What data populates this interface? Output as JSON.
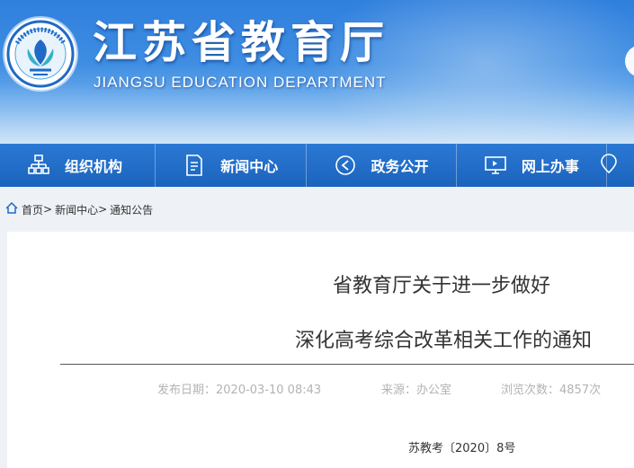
{
  "header": {
    "title": "江苏省教育厅",
    "subtitle": "JIANGSU EDUCATION DEPARTMENT",
    "logo_icon": "jiangsu-education-emblem"
  },
  "nav": {
    "items": [
      {
        "label": "组织机构",
        "icon": "org-chart-icon"
      },
      {
        "label": "新闻中心",
        "icon": "document-icon"
      },
      {
        "label": "政务公开",
        "icon": "announcement-icon"
      },
      {
        "label": "网上办事",
        "icon": "monitor-icon"
      }
    ]
  },
  "breadcrumb": {
    "home": "首页",
    "sep1": ">",
    "news": "新闻中心",
    "sep2": ">",
    "current": "通知公告"
  },
  "article": {
    "title_line1": "省教育厅关于进一步做好",
    "title_line2": "深化高考综合改革相关工作的通知",
    "publish_date": "发布日期：2020-03-10 08:43",
    "source": "来源：办公室",
    "views": "浏览次数：4857次",
    "doc_number": "苏教考〔2020〕8号"
  },
  "colors": {
    "nav_bg": "#1f6ac6",
    "header_blue": "#3f8ee3",
    "meta_gray": "#b3b3b3"
  }
}
